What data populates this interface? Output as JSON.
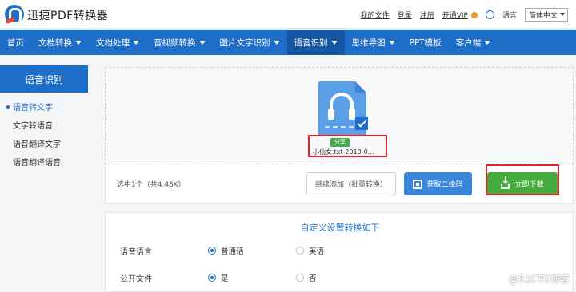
{
  "header": {
    "brand": "迅捷PDF转换器",
    "links": {
      "my_files": "我的文件",
      "login": "登录",
      "register": "注册",
      "vip": "开通VIP",
      "language_label": "语言",
      "language_value": "简体中文"
    }
  },
  "nav": {
    "items": [
      {
        "label": "首页",
        "dropdown": false
      },
      {
        "label": "文档转换",
        "dropdown": true
      },
      {
        "label": "文档处理",
        "dropdown": true
      },
      {
        "label": "音视频转换",
        "dropdown": true
      },
      {
        "label": "图片文字识别",
        "dropdown": true
      },
      {
        "label": "语音识别",
        "dropdown": true,
        "active": true
      },
      {
        "label": "思维导图",
        "dropdown": true
      },
      {
        "label": "PPT模板",
        "dropdown": false
      },
      {
        "label": "客户端",
        "dropdown": true
      }
    ]
  },
  "sidebar": {
    "title": "语音识别",
    "items": [
      {
        "label": "语音转文字",
        "active": true
      },
      {
        "label": "文字转语音"
      },
      {
        "label": "语音翻译文字"
      },
      {
        "label": "语音翻译语音"
      }
    ]
  },
  "file": {
    "share_badge": "分享",
    "name": "小仙女.txt-2019-0..."
  },
  "actions": {
    "selection_info": "选中1个（共4.48K）",
    "add_button": "继续添加（批量转换）",
    "qr_button": "获取二维码",
    "download_button": "立即下载"
  },
  "settings": {
    "title": "自定义设置转换如下",
    "rows": [
      {
        "label": "语音语言",
        "options": [
          {
            "label": "普通话",
            "selected": true
          },
          {
            "label": "英语",
            "selected": false
          }
        ]
      },
      {
        "label": "公开文件",
        "options": [
          {
            "label": "是",
            "selected": true
          },
          {
            "label": "否",
            "selected": false
          }
        ]
      }
    ]
  },
  "watermark": "@51CTO博客",
  "colors": {
    "primary": "#1d6ec8",
    "download_green": "#45ab3d",
    "highlight_red": "#e0232a"
  }
}
